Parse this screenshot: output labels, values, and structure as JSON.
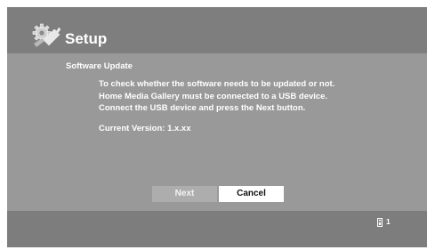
{
  "header": {
    "title": "Setup",
    "icon": "wrench-gear-icon"
  },
  "content": {
    "section_title": "Software Update",
    "messages": [
      "To check whether the software needs to be updated or not.",
      "Home Media Gallery must be connected to a USB device.",
      "Connect the USB device and press the Next button."
    ],
    "version_text": "Current Version: 1.x.xx"
  },
  "buttons": {
    "next_label": "Next",
    "cancel_label": "Cancel",
    "focused": "cancel"
  },
  "footer": {
    "icon": "remote-icon",
    "page_number": "1"
  },
  "colors": {
    "header_bg": "#7e7e7e",
    "content_bg": "#999999",
    "footer_bg": "#7d7d7d",
    "button_inactive": "#adadad",
    "button_focused": "#ffffff",
    "text": "#ffffff"
  }
}
